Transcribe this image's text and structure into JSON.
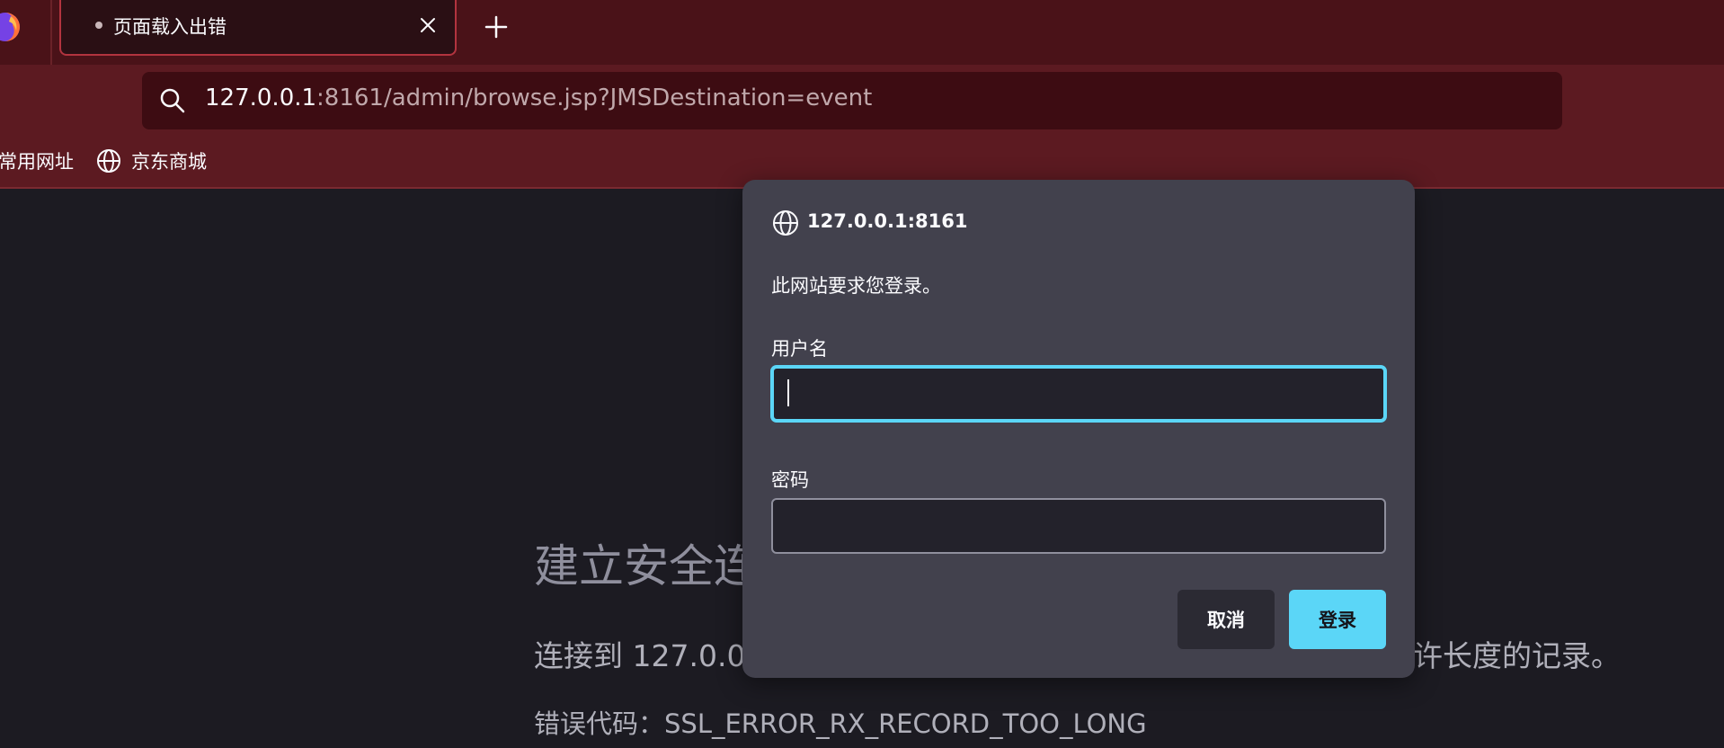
{
  "tab": {
    "title": "页面载入出错",
    "close_icon": "close-icon",
    "new_tab_icon": "plus-icon"
  },
  "urlbar": {
    "host": "127.0.0.1",
    "rest": ":8161/admin/browse.jsp?JMSDestination=event",
    "icon": "search-icon"
  },
  "bookmarks": {
    "items": [
      {
        "label": "常用网址"
      },
      {
        "label": "京东商城",
        "icon": "globe-icon"
      }
    ]
  },
  "error_page": {
    "title_fragment": "建立安全连",
    "desc_left_fragment": "连接到 127.0.0.",
    "desc_right_fragment": "许长度的记录。",
    "code_line": "错误代码：SSL_ERROR_RX_RECORD_TOO_LONG"
  },
  "dialog": {
    "host": "127.0.0.1:8161",
    "message": "此网站要求您登录。",
    "username_label": "用户名",
    "username_value": "",
    "password_label": "密码",
    "password_value": "",
    "cancel_label": "取消",
    "login_label": "登录"
  },
  "colors": {
    "tabstrip": "#4a1218",
    "navbar": "#5c1a21",
    "dialog_bg": "#42414d",
    "accent": "#5bd6f7"
  }
}
